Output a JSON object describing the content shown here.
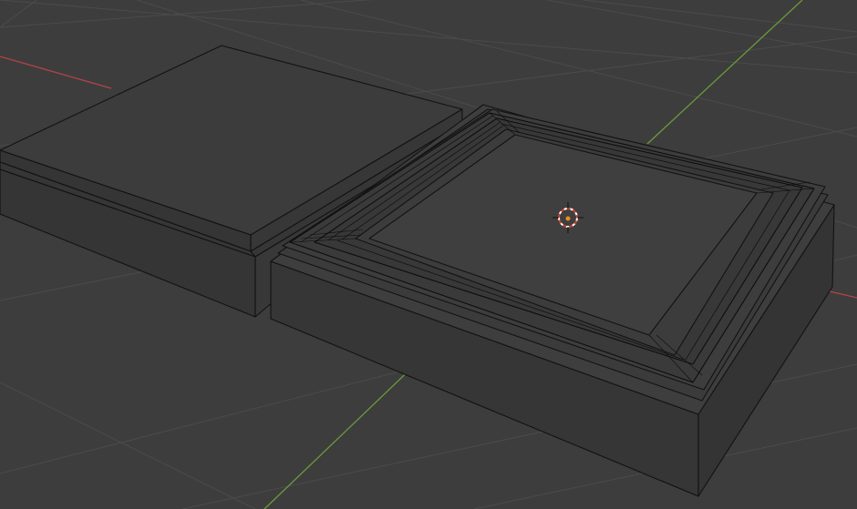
{
  "viewport": {
    "name": "3D Viewport",
    "objects": [
      {
        "id": "lid",
        "label": ""
      },
      {
        "id": "tray",
        "label": ""
      }
    ],
    "cursor": {
      "name": "3d-cursor"
    },
    "axes": {
      "x_color": "#b5434a",
      "y_color": "#6b9b3a"
    },
    "colors": {
      "background": "#3d3d3d",
      "grid": "#4a4a4a",
      "face": "#3b3b3b",
      "face_top": "#3f3f3f",
      "face_side": "#343434",
      "edge": "#111111"
    }
  }
}
